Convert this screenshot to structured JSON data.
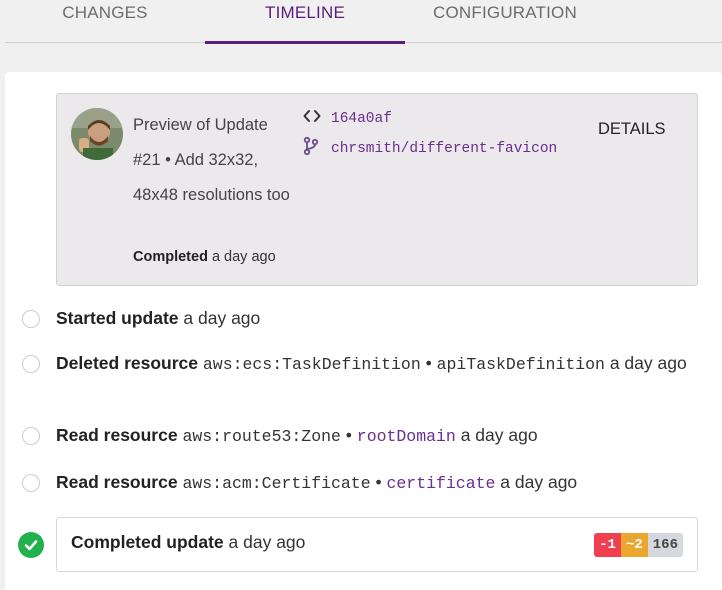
{
  "tabs": [
    {
      "label": "CHANGES",
      "active": false
    },
    {
      "label": "TIMELINE",
      "active": true
    },
    {
      "label": "CONFIGURATION",
      "active": false
    }
  ],
  "preview": {
    "title": "Preview of Update #21 • Add 32x32, 48x48 resolutions too",
    "status_label": "Completed",
    "status_time": "a day ago",
    "commit_icon": "code-icon",
    "commit": "164a0af",
    "branch_icon": "git-branch-icon",
    "branch": "chrsmith/different-favicon",
    "details_label": "DETAILS"
  },
  "events": [
    {
      "action": "Started update",
      "time": "a day ago"
    },
    {
      "action": "Deleted resource",
      "type": "aws:ecs:TaskDefinition",
      "sep": "•",
      "name": "apiTaskDefinition",
      "time": "a day ago"
    },
    {
      "action": "Read resource",
      "type": "aws:route53:Zone",
      "sep": "•",
      "name": "rootDomain",
      "time": "a day ago"
    },
    {
      "action": "Read resource",
      "type": "aws:acm:Certificate",
      "sep": "•",
      "name": "certificate",
      "time": "a day ago"
    }
  ],
  "completed": {
    "label": "Completed update",
    "time": "a day ago",
    "badges": {
      "deleted": "-1",
      "updated": "~2",
      "same": "166"
    }
  },
  "colors": {
    "accent": "#5a1f7a",
    "success": "#23b14d",
    "delete": "#f0404f",
    "update": "#eaa62e"
  }
}
